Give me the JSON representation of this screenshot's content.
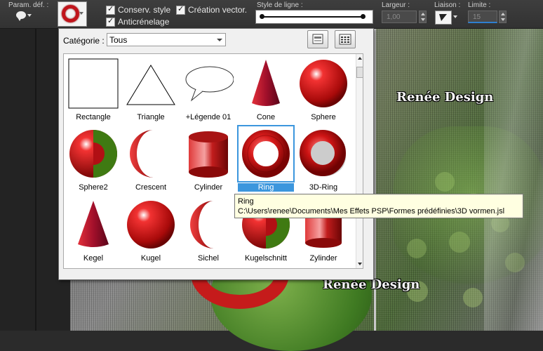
{
  "toolbar": {
    "presets_label": "Param. déf. :",
    "retain_style_label": "Conserv. style",
    "antialias_label": "Anticrénelage",
    "create_vector_label": "Création vector.",
    "line_style_label": "Style de ligne :",
    "width_label": "Largeur :",
    "width_value": "1,00",
    "join_label": "Liaison :",
    "limit_label": "Limite :",
    "limit_value": "15",
    "accent_color": "#c0141b"
  },
  "picker": {
    "category_label": "Catégorie :",
    "category_value": "Tous",
    "shapes": [
      {
        "label": "Rectangle",
        "icon": "rectangle-shape"
      },
      {
        "label": "Triangle",
        "icon": "triangle-shape"
      },
      {
        "label": "+Légende 01",
        "icon": "callout-shape"
      },
      {
        "label": "Cone",
        "icon": "cone-shape"
      },
      {
        "label": "Sphere",
        "icon": "sphere-shape"
      },
      {
        "label": "Sphere2",
        "icon": "sphere2-shape"
      },
      {
        "label": "Crescent",
        "icon": "crescent-shape"
      },
      {
        "label": "Cylinder",
        "icon": "cylinder-shape"
      },
      {
        "label": "Ring",
        "icon": "ring-shape"
      },
      {
        "label": "3D-Ring",
        "icon": "3d-ring-shape"
      },
      {
        "label": "Kegel",
        "icon": "cone-shape"
      },
      {
        "label": "Kugel",
        "icon": "sphere-shape"
      },
      {
        "label": "Sichel",
        "icon": "crescent-shape"
      },
      {
        "label": "Kugelschnitt",
        "icon": "sphere2-shape"
      },
      {
        "label": "Zylinder",
        "icon": "cylinder-shape"
      }
    ],
    "selected": "Ring"
  },
  "tooltip": {
    "title": "Ring",
    "path": "C:\\Users\\renee\\Documents\\Mes Effets PSP\\Formes prédéfinies\\3D vormen.jsl"
  },
  "watermark": "Renée Design"
}
